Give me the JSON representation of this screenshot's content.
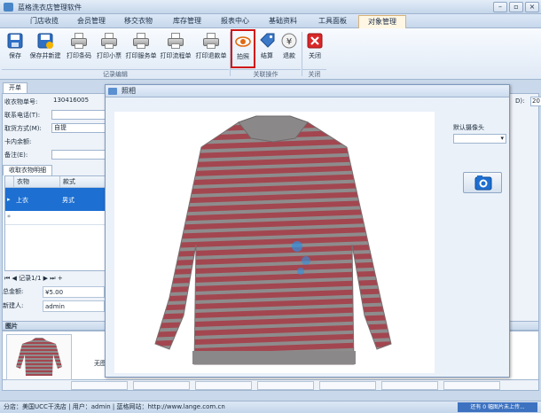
{
  "app": {
    "title": "蓝格洗衣店管理软件"
  },
  "menu": {
    "tabs": [
      "门店收揽",
      "会员管理",
      "移交衣物",
      "库存管理",
      "报表中心",
      "基础资料",
      "工具面板",
      "对象管理"
    ]
  },
  "ribbon": {
    "record_buttons": [
      "保存",
      "保存并新建",
      "打印条码",
      "打印小票",
      "打印服务单",
      "打印流程单",
      "打印退款单"
    ],
    "related_buttons": [
      "拍照",
      "结算",
      "退款"
    ],
    "close_button": "关闭",
    "groups": {
      "record": "记录编辑",
      "related": "关联操作",
      "close": "关闭"
    }
  },
  "form": {
    "doc_tab": "开单",
    "fields": [
      {
        "label": "收衣物单号:",
        "value": "130416005"
      },
      {
        "label": "联系电话(T):",
        "value": ""
      },
      {
        "label": "取货方式(M):",
        "value": "自提"
      },
      {
        "label": "卡内余额:",
        "value": ""
      },
      {
        "label": "备注(E):",
        "value": ""
      }
    ],
    "corner_label": "D):",
    "corner_value": "20"
  },
  "grid": {
    "tab": "收取衣物明细",
    "headers": [
      "衣物",
      "款式"
    ],
    "rows": [
      {
        "item": "上衣",
        "style": "男式"
      }
    ],
    "pager_text": "记录1/1"
  },
  "summary": {
    "total_label": "总金额:",
    "total_value": "¥5.00",
    "creator_label": "新建人:",
    "creator_value": "admin"
  },
  "pictures": {
    "header": "图片",
    "no_pic": "无图"
  },
  "status": {
    "left": "分店：美国UCC干洗店 | 用户：admin | 蓝格网站：http://www.lange.com.cn",
    "right": "还有 0 幅图片未上传..."
  },
  "modal": {
    "title": "照相",
    "camera_label": "默认摄像头",
    "camera_value": ""
  },
  "colors": {
    "accent": "#1d6fd1",
    "shirt_red": "#a3464f",
    "shirt_grey": "#8e8c8d",
    "highlight": "#d11414"
  }
}
